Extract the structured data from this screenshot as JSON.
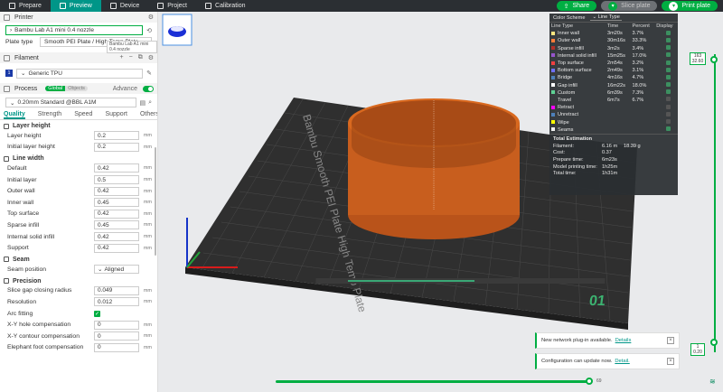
{
  "topbar": {
    "tabs": [
      {
        "label": "Prepare",
        "icon": "prepare-icon"
      },
      {
        "label": "Preview",
        "icon": "preview-icon"
      },
      {
        "label": "Device",
        "icon": "device-icon"
      },
      {
        "label": "Project",
        "icon": "project-icon"
      },
      {
        "label": "Calibration",
        "icon": "calibration-icon"
      }
    ],
    "share_label": "Share",
    "slice_label": "Slice plate",
    "print_label": "Print plate"
  },
  "printer": {
    "section_label": "Printer",
    "selected": "Bambu Lab A1 mini 0.4 nozzle",
    "tooltip": "Bambu Lab A1 mini 0.4 nozzle",
    "plate_type_label": "Plate type",
    "plate_type_value": "Smooth PEI Plate / High Temp Plate"
  },
  "filament": {
    "section_label": "Filament",
    "selected": "Generic TPU",
    "slot_number": "1"
  },
  "process": {
    "section_label": "Process",
    "global_label": "Global",
    "objects_label": "Objects",
    "advance_label": "Advance",
    "preset": "0.20mm Standard @BBL A1M",
    "tabs": [
      "Quality",
      "Strength",
      "Speed",
      "Support",
      "Others"
    ]
  },
  "groups": {
    "layer_height": {
      "title": "Layer height",
      "params": [
        {
          "label": "Layer height",
          "value": "0.2",
          "unit": "mm"
        },
        {
          "label": "Initial layer height",
          "value": "0.2",
          "unit": "mm"
        }
      ]
    },
    "line_width": {
      "title": "Line width",
      "params": [
        {
          "label": "Default",
          "value": "0.42",
          "unit": "mm"
        },
        {
          "label": "Initial layer",
          "value": "0.5",
          "unit": "mm"
        },
        {
          "label": "Outer wall",
          "value": "0.42",
          "unit": "mm"
        },
        {
          "label": "Inner wall",
          "value": "0.45",
          "unit": "mm"
        },
        {
          "label": "Top surface",
          "value": "0.42",
          "unit": "mm"
        },
        {
          "label": "Sparse infill",
          "value": "0.45",
          "unit": "mm"
        },
        {
          "label": "Internal solid infill",
          "value": "0.42",
          "unit": "mm"
        },
        {
          "label": "Support",
          "value": "0.42",
          "unit": "mm"
        }
      ]
    },
    "seam": {
      "title": "Seam",
      "position_label": "Seam position",
      "position_value": "Aligned"
    },
    "precision": {
      "title": "Precision",
      "params": [
        {
          "label": "Slice gap closing radius",
          "value": "0.049",
          "unit": "mm"
        },
        {
          "label": "Resolution",
          "value": "0.012",
          "unit": "mm"
        }
      ],
      "arc_label": "Arc fitting",
      "params2": [
        {
          "label": "X-Y hole compensation",
          "value": "0",
          "unit": "mm"
        },
        {
          "label": "X-Y contour compensation",
          "value": "0",
          "unit": "mm"
        },
        {
          "label": "Elephant foot compensation",
          "value": "0",
          "unit": "mm"
        }
      ]
    }
  },
  "color_scheme": {
    "title": "Color Scheme",
    "mode": "Line Type",
    "headers": [
      "Line Type",
      "Time",
      "Percent",
      "Display"
    ],
    "rows": [
      {
        "name": "Inner wall",
        "time": "3m20s",
        "percent": "3.7%",
        "color": "#ffe680",
        "on": true
      },
      {
        "name": "Outer wall",
        "time": "30m16s",
        "percent": "33.3%",
        "color": "#ff7d38",
        "on": true
      },
      {
        "name": "Sparse infill",
        "time": "3m2s",
        "percent": "3.4%",
        "color": "#b03029",
        "on": true
      },
      {
        "name": "Internal solid infill",
        "time": "15m25s",
        "percent": "17.0%",
        "color": "#9654cc",
        "on": true
      },
      {
        "name": "Top surface",
        "time": "2m54s",
        "percent": "3.2%",
        "color": "#f04040",
        "on": true
      },
      {
        "name": "Bottom surface",
        "time": "2m49s",
        "percent": "3.1%",
        "color": "#7070ff",
        "on": true
      },
      {
        "name": "Bridge",
        "time": "4m16s",
        "percent": "4.7%",
        "color": "#4d80ba",
        "on": true
      },
      {
        "name": "Gap infill",
        "time": "16m22s",
        "percent": "18.0%",
        "color": "#ffffff",
        "on": true
      },
      {
        "name": "Custom",
        "time": "6m39s",
        "percent": "7.3%",
        "color": "#5ed194",
        "on": true
      },
      {
        "name": "Travel",
        "time": "6m7s",
        "percent": "6.7%",
        "color": "",
        "on": false
      },
      {
        "name": "Retract",
        "time": "",
        "percent": "",
        "color": "#ff00ff",
        "on": false
      },
      {
        "name": "Unretract",
        "time": "",
        "percent": "",
        "color": "#4d80ba",
        "on": false
      },
      {
        "name": "Wipe",
        "time": "",
        "percent": "",
        "color": "#ffff00",
        "on": false
      },
      {
        "name": "Seams",
        "time": "",
        "percent": "",
        "color": "#f0f0f0",
        "on": true
      }
    ],
    "estimation_title": "Total Estimation",
    "estimation": [
      {
        "label": "Filament:",
        "value": "6.16 m",
        "extra": "18.39 g"
      },
      {
        "label": "Cost:",
        "value": "0.37",
        "extra": ""
      },
      {
        "label": "Prepare time:",
        "value": "6m23s",
        "extra": ""
      },
      {
        "label": "Model printing time:",
        "value": "1h25m",
        "extra": ""
      },
      {
        "label": "Total time:",
        "value": "1h31m",
        "extra": ""
      }
    ]
  },
  "plate": {
    "brand_text": "Bambu Smooth PEI Plate High Temp Plate",
    "number": "01"
  },
  "layer_slider": {
    "top_value": "163",
    "top_height": "32.60",
    "bottom_value": "1",
    "bottom_height": "0.20"
  },
  "move_slider": {
    "value": "69"
  },
  "notifications": [
    {
      "text": "New network plug-in available.",
      "link": "Details"
    },
    {
      "text": "Configuration can update now.",
      "link": "Detail."
    }
  ]
}
